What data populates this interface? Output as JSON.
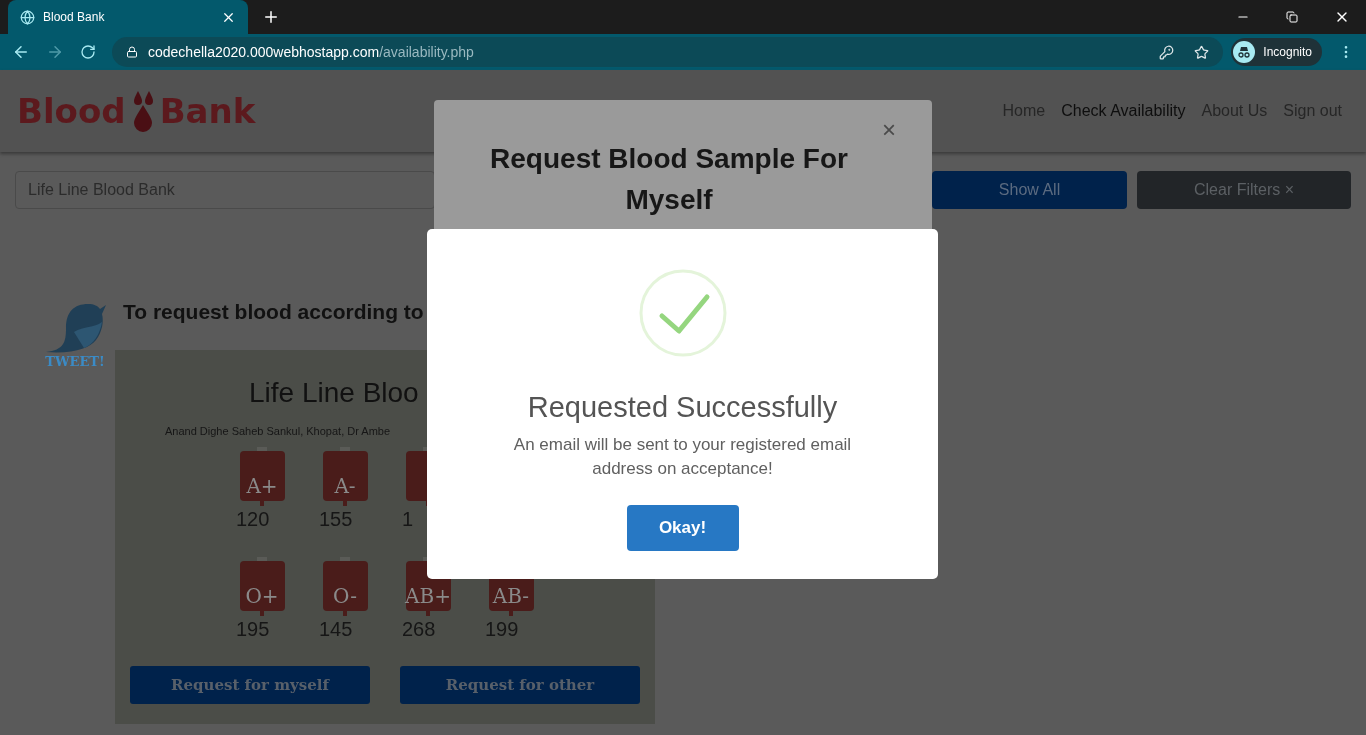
{
  "browser": {
    "tab": {
      "title": "Blood Bank"
    },
    "url": {
      "host": "codechella2020.000webhostapp.com",
      "path": "/availability.php"
    },
    "profile": "Incognito"
  },
  "header": {
    "logo": {
      "left": "Blood",
      "right": "Bank"
    },
    "nav": [
      {
        "label": "Home",
        "selected": false
      },
      {
        "label": "Check Availability",
        "selected": true
      },
      {
        "label": "About Us",
        "selected": false
      },
      {
        "label": "Sign out",
        "selected": false
      }
    ]
  },
  "filters": {
    "search": {
      "value": "Life Line Blood Bank"
    },
    "buttons": [
      {
        "label": "Show All",
        "kind": "primary"
      },
      {
        "label": "Clear Filters ×",
        "kind": "dark"
      }
    ]
  },
  "tweet": {
    "label": "TWEET!"
  },
  "intro": "To request blood according to",
  "card": {
    "name": "Life Line Bloo",
    "address": "Anand Dighe Saheb Sankul, Khopat, Dr Ambe",
    "rows": [
      [
        {
          "group": "A+",
          "units": "120"
        },
        {
          "group": "A-",
          "units": "155"
        },
        {
          "units": "1"
        }
      ],
      [
        {
          "group": "O+",
          "units": "195"
        },
        {
          "group": "O-",
          "units": "145"
        },
        {
          "group": "AB+",
          "units": "268"
        },
        {
          "group": "AB-",
          "units": "199"
        }
      ]
    ],
    "buttons": [
      "Request for myself",
      "Request for other"
    ]
  },
  "request_modal": {
    "title": "Request Blood Sample For Myself",
    "close": "×"
  },
  "success_modal": {
    "title": "Requested Successfully",
    "message": "An email will be sent to your registered email address on acceptance!",
    "button": "Okay!"
  }
}
